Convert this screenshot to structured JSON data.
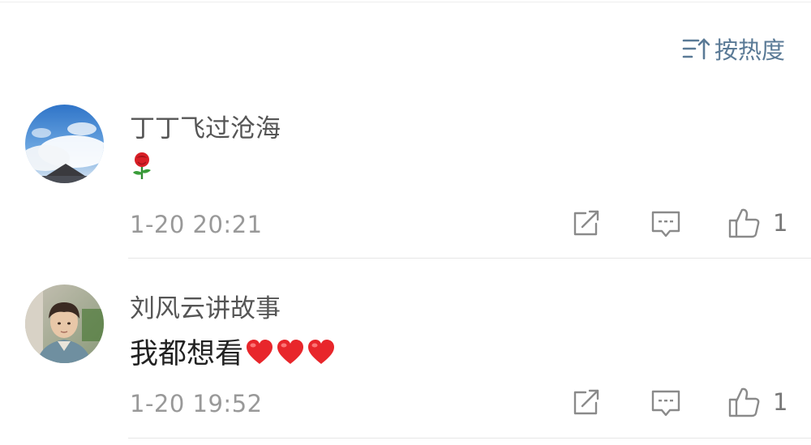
{
  "sort": {
    "label": "按热度",
    "icon": "sort-icon"
  },
  "comments": [
    {
      "username": "丁丁飞过沧海",
      "content_text": "",
      "content_emoji": [
        "rose"
      ],
      "time": "1-20 20:21",
      "like_count": "1",
      "icons": [
        "share-icon",
        "comment-icon",
        "thumbs-up-icon"
      ]
    },
    {
      "username": "刘风云讲故事",
      "content_text": "我都想看",
      "content_emoji": [
        "heart",
        "heart",
        "heart"
      ],
      "time": "1-20 19:52",
      "like_count": "1",
      "icons": [
        "share-icon",
        "comment-icon",
        "thumbs-up-icon"
      ]
    }
  ],
  "colors": {
    "link": "#5a7a96",
    "username": "#555555",
    "meta": "#999999",
    "icon": "#8a8a8a",
    "heart": "#e8262b"
  }
}
